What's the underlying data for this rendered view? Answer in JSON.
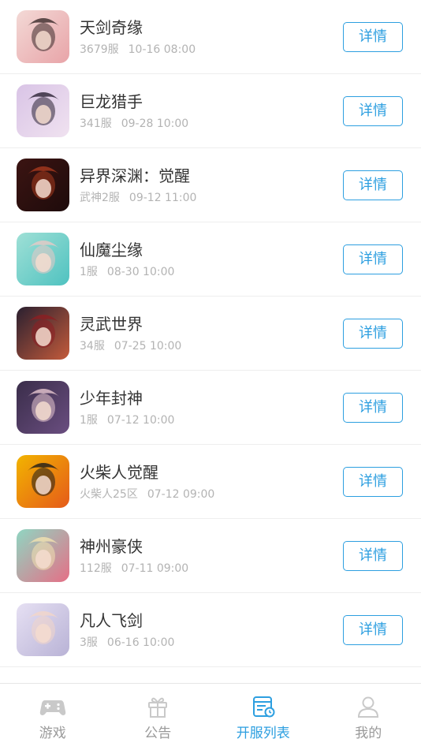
{
  "games": [
    {
      "title": "天剑奇缘",
      "server": "3679服",
      "time": "10-16 08:00",
      "button": "详情",
      "icon": "anime-girl-white-hair-icon",
      "colors": [
        "#f3d9d6",
        "#3a2a2a",
        "#e8a4a8"
      ]
    },
    {
      "title": "巨龙猎手",
      "server": "341服",
      "time": "09-28 10:00",
      "button": "详情",
      "icon": "swordswoman-icon",
      "colors": [
        "#d9c4e6",
        "#2b2233",
        "#f0e2f0"
      ]
    },
    {
      "title": "异界深渊：觉醒",
      "server": "武神2服",
      "time": "09-12 11:00",
      "button": "详情",
      "icon": "warrior-icon",
      "colors": [
        "#3b1412",
        "#a83a1e",
        "#1e0b0b"
      ]
    },
    {
      "title": "仙魔尘缘",
      "server": "1服",
      "time": "08-30 10:00",
      "button": "详情",
      "icon": "teal-hair-girl-icon",
      "colors": [
        "#9fe0d6",
        "#e9c9c6",
        "#4fc2c0"
      ]
    },
    {
      "title": "灵武世界",
      "server": "34服",
      "time": "07-25 10:00",
      "button": "详情",
      "icon": "dark-hero-icon",
      "colors": [
        "#2a2030",
        "#8c1e22",
        "#c45b3b"
      ]
    },
    {
      "title": "少年封神",
      "server": "1服",
      "time": "07-12 10:00",
      "button": "详情",
      "icon": "purple-hair-girl-icon",
      "colors": [
        "#3a2d4a",
        "#e6c7cf",
        "#6a4e80"
      ]
    },
    {
      "title": "火柴人觉醒",
      "server": "火柴人25区",
      "time": "07-12 09:00",
      "button": "详情",
      "icon": "stickman-fox-icon",
      "colors": [
        "#f2b400",
        "#1b1b1b",
        "#e55a1a"
      ]
    },
    {
      "title": "神州豪侠",
      "server": "112服",
      "time": "07-11 09:00",
      "button": "详情",
      "icon": "cat-hat-girl-icon",
      "colors": [
        "#8fd6c2",
        "#f3e2b0",
        "#e56f86"
      ]
    },
    {
      "title": "凡人飞剑",
      "server": "3服",
      "time": "06-16 10:00",
      "button": "详情",
      "icon": "white-hair-boy-icon",
      "colors": [
        "#e6e0f3",
        "#f3d6c8",
        "#b9b3d6"
      ]
    }
  ],
  "tabs": [
    {
      "label": "游戏",
      "icon": "gamepad-icon",
      "active": false
    },
    {
      "label": "公告",
      "icon": "gift-icon",
      "active": false
    },
    {
      "label": "开服列表",
      "icon": "server-list-icon",
      "active": true
    },
    {
      "label": "我的",
      "icon": "user-icon",
      "active": false
    }
  ],
  "colors": {
    "accent": "#2d9fe0",
    "muted": "#999999",
    "text": "#333333",
    "subtext": "#b3b3b3"
  }
}
